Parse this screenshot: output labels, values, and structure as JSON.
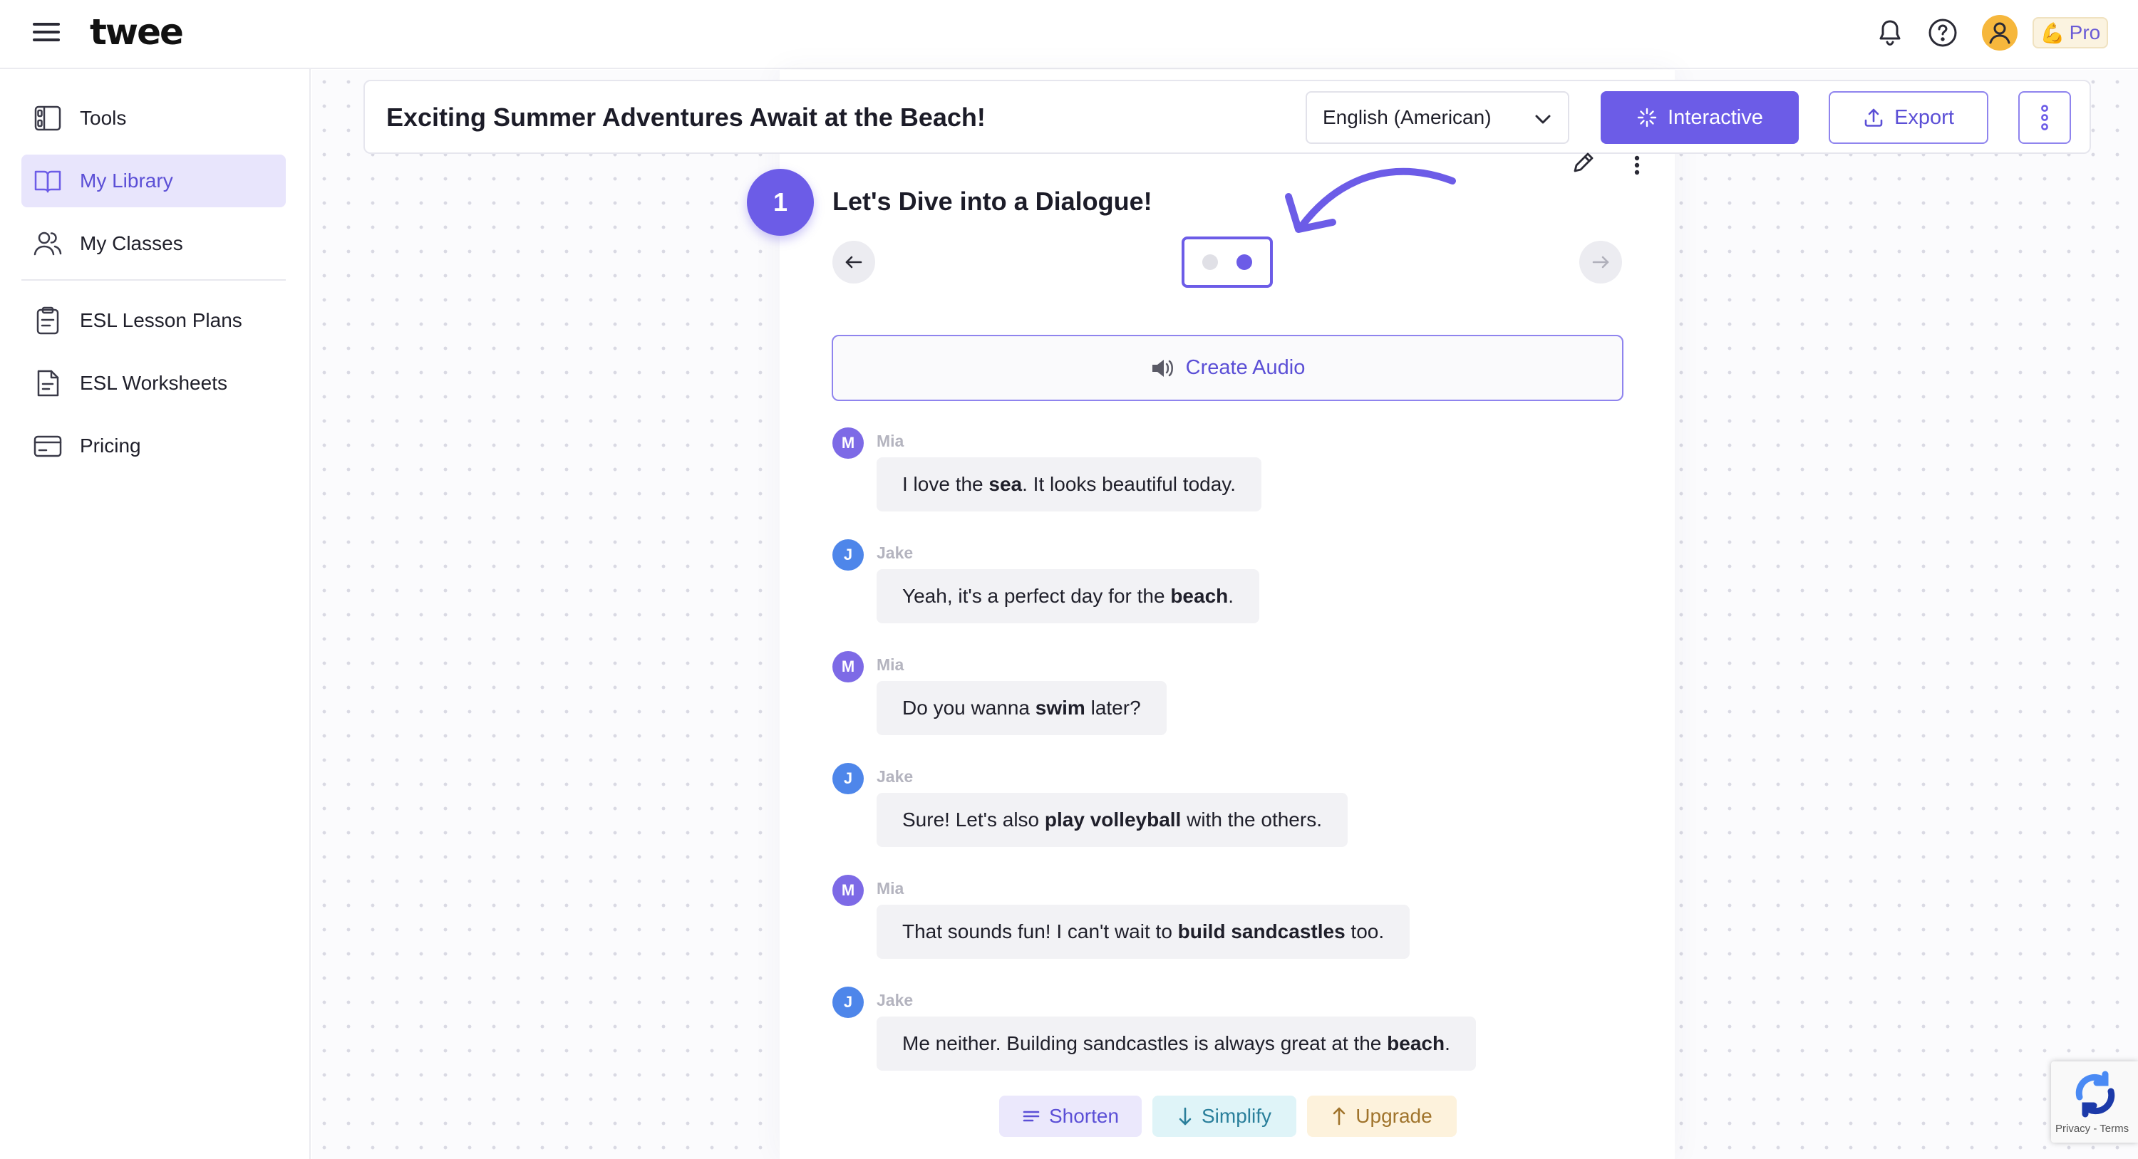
{
  "app": {
    "logo": "twee",
    "pro_label": "Pro",
    "pro_emoji": "💪"
  },
  "sidebar": {
    "items": [
      {
        "label": "Tools",
        "icon": "tools-icon"
      },
      {
        "label": "My Library",
        "icon": "library-book-icon",
        "active": true
      },
      {
        "label": "My Classes",
        "icon": "users-icon"
      },
      {
        "label": "ESL Lesson Plans",
        "icon": "clipboard-icon"
      },
      {
        "label": "ESL Worksheets",
        "icon": "worksheet-icon"
      },
      {
        "label": "Pricing",
        "icon": "credit-card-icon"
      }
    ]
  },
  "header": {
    "title": "Exciting Summer Adventures Await at the Beach!",
    "language": "English (American)",
    "interactive_label": "Interactive",
    "export_label": "Export"
  },
  "section": {
    "number": "1",
    "title": "Let's Dive into a Dialogue!",
    "pager": {
      "total": 2,
      "current": 2
    },
    "create_audio_label": "Create Audio"
  },
  "dialogue": [
    {
      "speaker": "Mia",
      "initial": "M",
      "parts": [
        [
          "I love the ",
          false
        ],
        [
          "sea",
          true
        ],
        [
          ". It looks beautiful today.",
          false
        ]
      ]
    },
    {
      "speaker": "Jake",
      "initial": "J",
      "parts": [
        [
          "Yeah, it's a perfect day for the ",
          false
        ],
        [
          "beach",
          true
        ],
        [
          ".",
          false
        ]
      ]
    },
    {
      "speaker": "Mia",
      "initial": "M",
      "parts": [
        [
          "Do you wanna ",
          false
        ],
        [
          "swim",
          true
        ],
        [
          " later?",
          false
        ]
      ]
    },
    {
      "speaker": "Jake",
      "initial": "J",
      "parts": [
        [
          "Sure! Let's also ",
          false
        ],
        [
          "play volleyball",
          true
        ],
        [
          " with the others.",
          false
        ]
      ]
    },
    {
      "speaker": "Mia",
      "initial": "M",
      "parts": [
        [
          "That sounds fun! I can't wait to ",
          false
        ],
        [
          "build sandcastles",
          true
        ],
        [
          " too.",
          false
        ]
      ]
    },
    {
      "speaker": "Jake",
      "initial": "J",
      "parts": [
        [
          "Me neither. Building sandcastles is always great at the ",
          false
        ],
        [
          "beach",
          true
        ],
        [
          ".",
          false
        ]
      ]
    }
  ],
  "actions": {
    "shorten": "Shorten",
    "simplify": "Simplify",
    "upgrade": "Upgrade"
  },
  "recaptcha": {
    "text": "Privacy - Terms"
  },
  "colors": {
    "accent": "#6c5ce7",
    "active_nav_bg": "#e8e5fc",
    "mia_avatar": "#7d6ae6",
    "jake_avatar": "#4e86ea"
  }
}
